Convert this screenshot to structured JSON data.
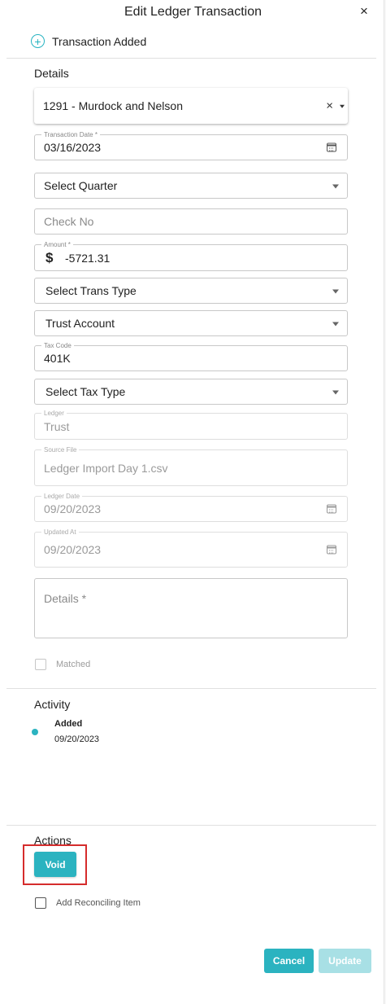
{
  "header": {
    "title": "Edit Ledger Transaction",
    "close_label": "×"
  },
  "status": {
    "icon": "plus-circle-icon",
    "text": "Transaction Added"
  },
  "details": {
    "section_title": "Details",
    "client": {
      "value": "1291 - Murdock and Nelson",
      "clear_label": "×"
    },
    "transaction_date": {
      "label": "Transaction Date *",
      "value": "03/16/2023"
    },
    "quarter": {
      "placeholder": "Select Quarter"
    },
    "check_no": {
      "placeholder": "Check No"
    },
    "amount": {
      "label": "Amount *",
      "currency_symbol": "$",
      "value": "-5721.31"
    },
    "trans_type": {
      "placeholder": "Select Trans Type"
    },
    "account": {
      "value": "Trust Account"
    },
    "tax_code": {
      "label": "Tax Code",
      "value": "401K"
    },
    "tax_type": {
      "placeholder": "Select Tax Type"
    },
    "ledger": {
      "label": "Ledger",
      "value": "Trust"
    },
    "source_file": {
      "label": "Source File",
      "value": "Ledger Import Day 1.csv"
    },
    "ledger_date": {
      "label": "Ledger Date",
      "value": "09/20/2023"
    },
    "updated_at": {
      "label": "Updated At",
      "value": "09/20/2023"
    },
    "details_text": {
      "placeholder": "Details *"
    },
    "matched": {
      "label": "Matched",
      "checked": false
    }
  },
  "activity": {
    "section_title": "Activity",
    "items": [
      {
        "title": "Added",
        "date": "09/20/2023"
      }
    ]
  },
  "actions": {
    "section_title": "Actions",
    "void_label": "Void",
    "reconciling": {
      "label": "Add Reconciling Item",
      "checked": false
    }
  },
  "footer": {
    "cancel_label": "Cancel",
    "update_label": "Update"
  },
  "colors": {
    "accent": "#2bb3c0",
    "accent_disabled": "#a8e0e5",
    "highlight": "#d52c2c"
  }
}
